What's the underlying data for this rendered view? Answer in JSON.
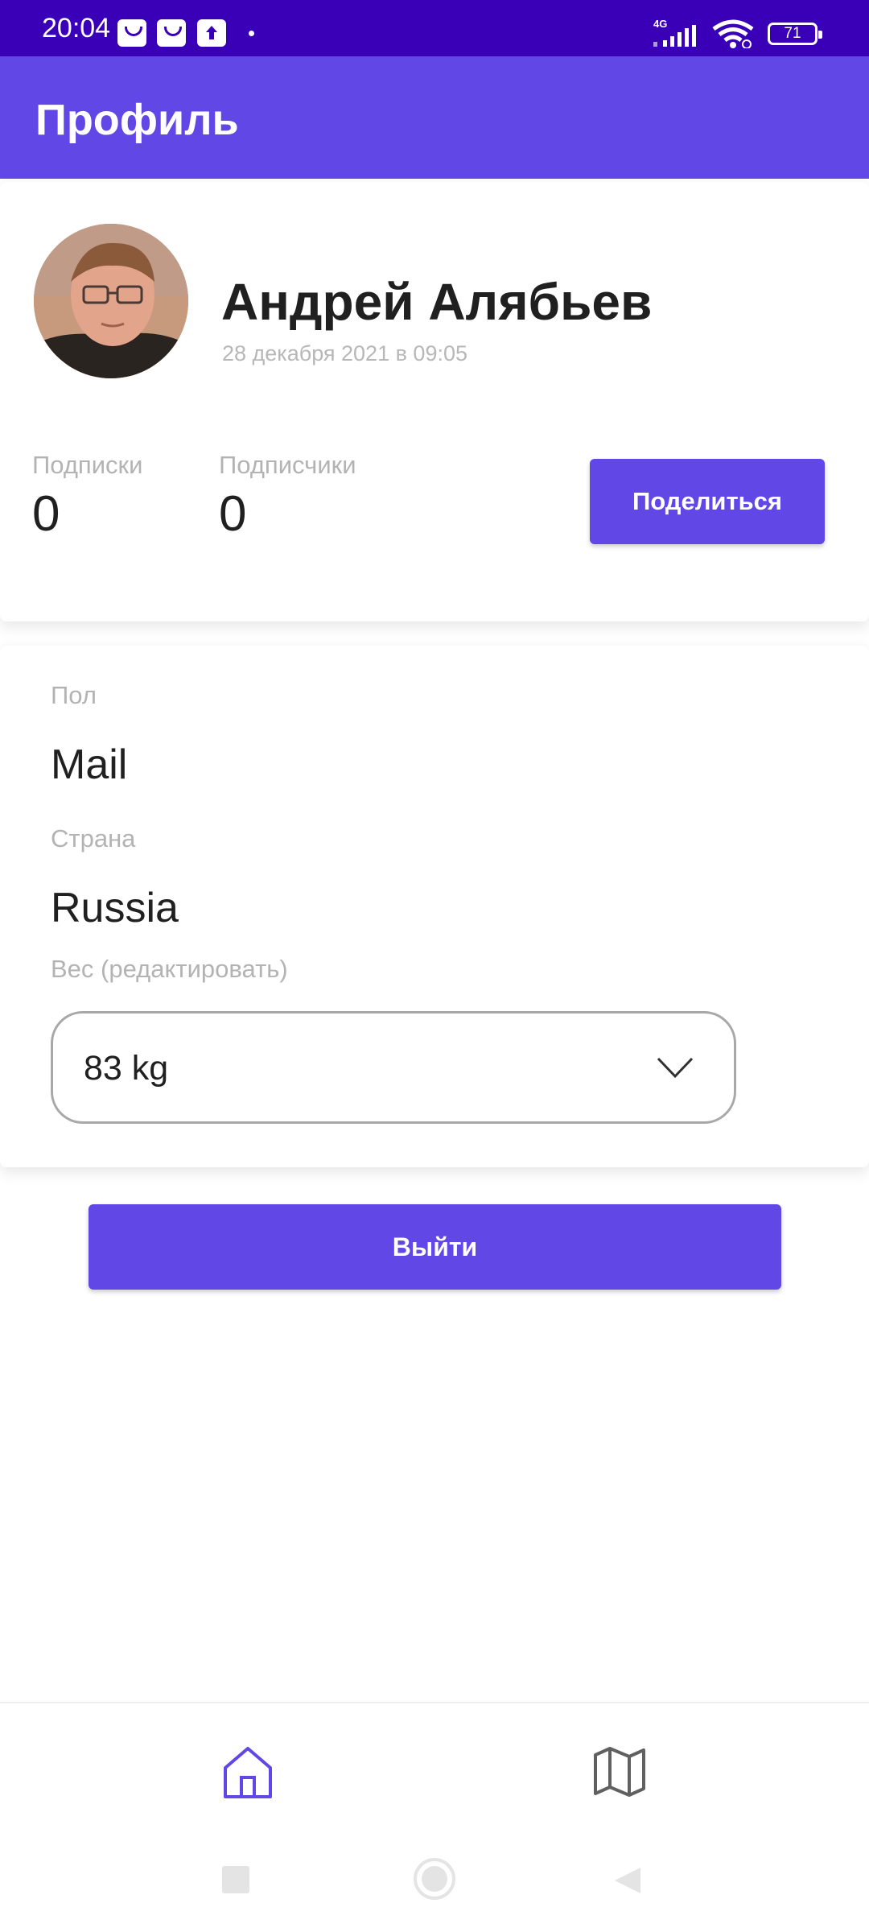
{
  "status_bar": {
    "time": "20:04",
    "network": "4G",
    "battery": "71"
  },
  "app_bar": {
    "title": "Профиль"
  },
  "profile": {
    "name": "Андрей Алябьев",
    "date": "28 декабря 2021 в 09:05",
    "subscriptions_label": "Подписки",
    "subscriptions_count": "0",
    "followers_label": "Подписчики",
    "followers_count": "0",
    "share_label": "Поделиться"
  },
  "details": {
    "gender_label": "Пол",
    "gender_value": "Mail",
    "country_label": "Страна",
    "country_value": "Russia",
    "weight_label": "Вес (редактировать)",
    "weight_value": "83 kg"
  },
  "logout_label": "Выйти",
  "bottom_nav": {
    "items": [
      {
        "icon": "home-icon",
        "selected": true
      },
      {
        "icon": "map-icon",
        "selected": false
      }
    ]
  },
  "colors": {
    "status_bar": "#3a00b8",
    "primary": "#6047e6",
    "text": "#202020",
    "muted": "#b3b3b3"
  }
}
